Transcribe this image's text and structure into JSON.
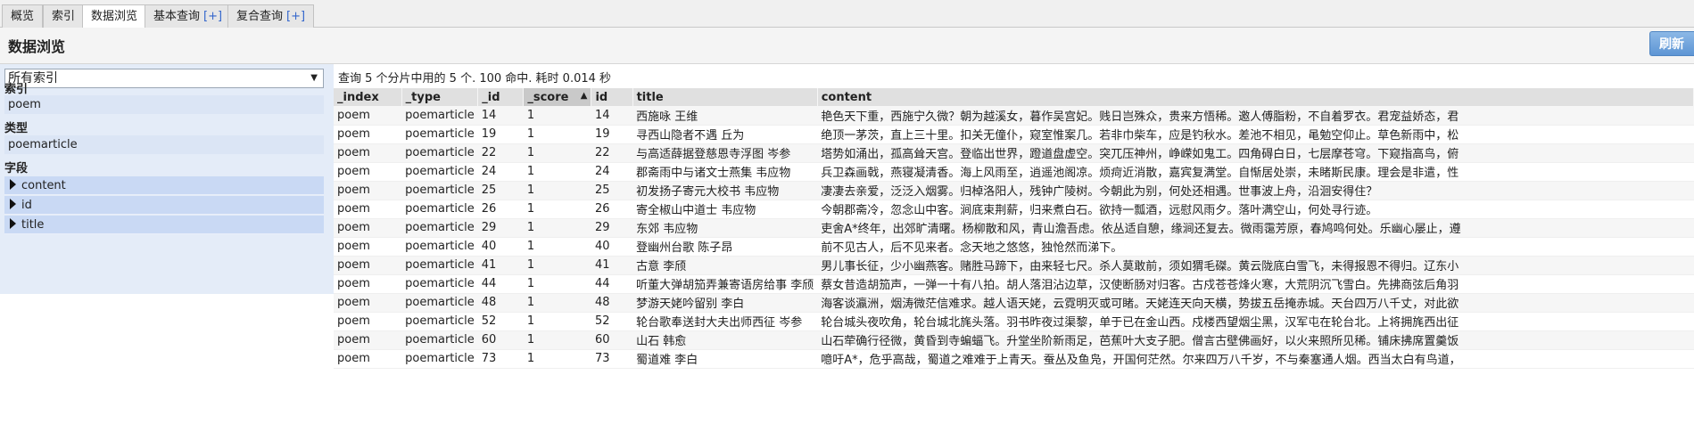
{
  "tabs": [
    {
      "label": "概览",
      "plus": "",
      "left": 0
    },
    {
      "label": "索引",
      "plus": "",
      "left": 0
    },
    {
      "label": "数据浏览",
      "plus": "",
      "active": true
    },
    {
      "label": "基本查询",
      "plus": "[+]"
    },
    {
      "label": "复合查询",
      "plus": "[+]"
    }
  ],
  "header": {
    "title": "数据浏览",
    "refresh_label": "刷新"
  },
  "sidebar": {
    "select_value": "所有索引",
    "index_heading": "索引",
    "index_item": "poem",
    "type_heading": "类型",
    "type_item": "poemarticle",
    "field_heading": "字段",
    "fields": [
      "content",
      "id",
      "title"
    ]
  },
  "results": {
    "summary": "查询 5 个分片中用的 5 个. 100 命中. 耗时 0.014 秒",
    "columns": [
      "_index",
      "_type",
      "_id",
      "_score",
      "id",
      "title",
      "content"
    ],
    "sorted_column": "_score",
    "rows": [
      [
        "poem",
        "poemarticle",
        "14",
        "1",
        "14",
        "西施咏 王维",
        "艳色天下重，西施宁久微？朝为越溪女，暮作吴宫妃。贱日岂殊众，贵来方悟稀。邀人傅脂粉，不自着罗衣。君宠益娇态，君"
      ],
      [
        "poem",
        "poemarticle",
        "19",
        "1",
        "19",
        "寻西山隐者不遇 丘为",
        "绝顶一茅茨，直上三十里。扣关无僮仆，窥室惟案几。若非巾柴车，应是钓秋水。差池不相见，黾勉空仰止。草色新雨中，松"
      ],
      [
        "poem",
        "poemarticle",
        "22",
        "1",
        "22",
        "与高适薛据登慈恩寺浮图 岑参",
        "塔势如涌出，孤高耸天宫。登临出世界，蹬道盘虚空。突兀压神州，峥嵘如鬼工。四角碍白日，七层摩苍穹。下窥指高鸟，俯"
      ],
      [
        "poem",
        "poemarticle",
        "24",
        "1",
        "24",
        "郡斋雨中与诸文士燕集 韦应物",
        "兵卫森画戟，燕寝凝清香。海上风雨至，逍遥池阁凉。烦疴近消散，嘉宾复满堂。自惭居处崇，未睹斯民康。理会是非遣，性"
      ],
      [
        "poem",
        "poemarticle",
        "25",
        "1",
        "25",
        "初发扬子寄元大校书 韦应物",
        "凄凄去亲爱，泛泛入烟雾。归棹洛阳人，残钟广陵树。今朝此为别，何处还相遇。世事波上舟，沿洄安得住？"
      ],
      [
        "poem",
        "poemarticle",
        "26",
        "1",
        "26",
        "寄全椒山中道士 韦应物",
        "今朝郡斋冷，忽念山中客。涧底束荆薪，归来煮白石。欲持一瓢酒，远慰风雨夕。落叶满空山，何处寻行迹。"
      ],
      [
        "poem",
        "poemarticle",
        "29",
        "1",
        "29",
        "东郊 韦应物",
        "吏舍A*终年，出郊旷清曙。杨柳散和风，青山澹吾虑。依丛适自憩，缘涧还复去。微雨霭芳原，春鸠鸣何处。乐幽心屡止，遵"
      ],
      [
        "poem",
        "poemarticle",
        "40",
        "1",
        "40",
        "登幽州台歌 陈子昂",
        "前不见古人，后不见来者。念天地之悠悠，独怆然而涕下。"
      ],
      [
        "poem",
        "poemarticle",
        "41",
        "1",
        "41",
        "古意 李颀",
        "男儿事长征，少小幽燕客。赌胜马蹄下，由来轻七尺。杀人莫敢前，须如猬毛磔。黄云陇底白雪飞，未得报恩不得归。辽东小"
      ],
      [
        "poem",
        "poemarticle",
        "44",
        "1",
        "44",
        "听董大弹胡笳弄兼寄语房给事 李颀",
        "蔡女昔造胡笳声，一弹一十有八拍。胡人落泪沾边草，汉使断肠对归客。古戍苍苍烽火寒，大荒阴沉飞雪白。先拂商弦后角羽"
      ],
      [
        "poem",
        "poemarticle",
        "48",
        "1",
        "48",
        "梦游天姥吟留别 李白",
        "海客谈瀛洲，烟涛微茫信难求。越人语天姥，云霓明灭或可睹。天姥连天向天横，势拔五岳掩赤城。天台四万八千丈，对此欲"
      ],
      [
        "poem",
        "poemarticle",
        "52",
        "1",
        "52",
        "轮台歌奉送封大夫出师西征 岑参",
        "轮台城头夜吹角，轮台城北旄头落。羽书昨夜过渠黎，单于已在金山西。戍楼西望烟尘黑，汉军屯在轮台北。上将拥旄西出征"
      ],
      [
        "poem",
        "poemarticle",
        "60",
        "1",
        "60",
        "山石 韩愈",
        "山石荦确行径微，黄昏到寺蝙蝠飞。升堂坐阶新雨足，芭蕉叶大支子肥。僧言古壁佛画好，以火来照所见稀。铺床拂席置羹饭"
      ],
      [
        "poem",
        "poemarticle",
        "73",
        "1",
        "73",
        "蜀道难 李白",
        "噫吁A*，危乎高哉，蜀道之难难于上青天。蚕丛及鱼凫，开国何茫然。尔来四万八千岁，不与秦塞通人烟。西当太白有鸟道，"
      ]
    ]
  }
}
